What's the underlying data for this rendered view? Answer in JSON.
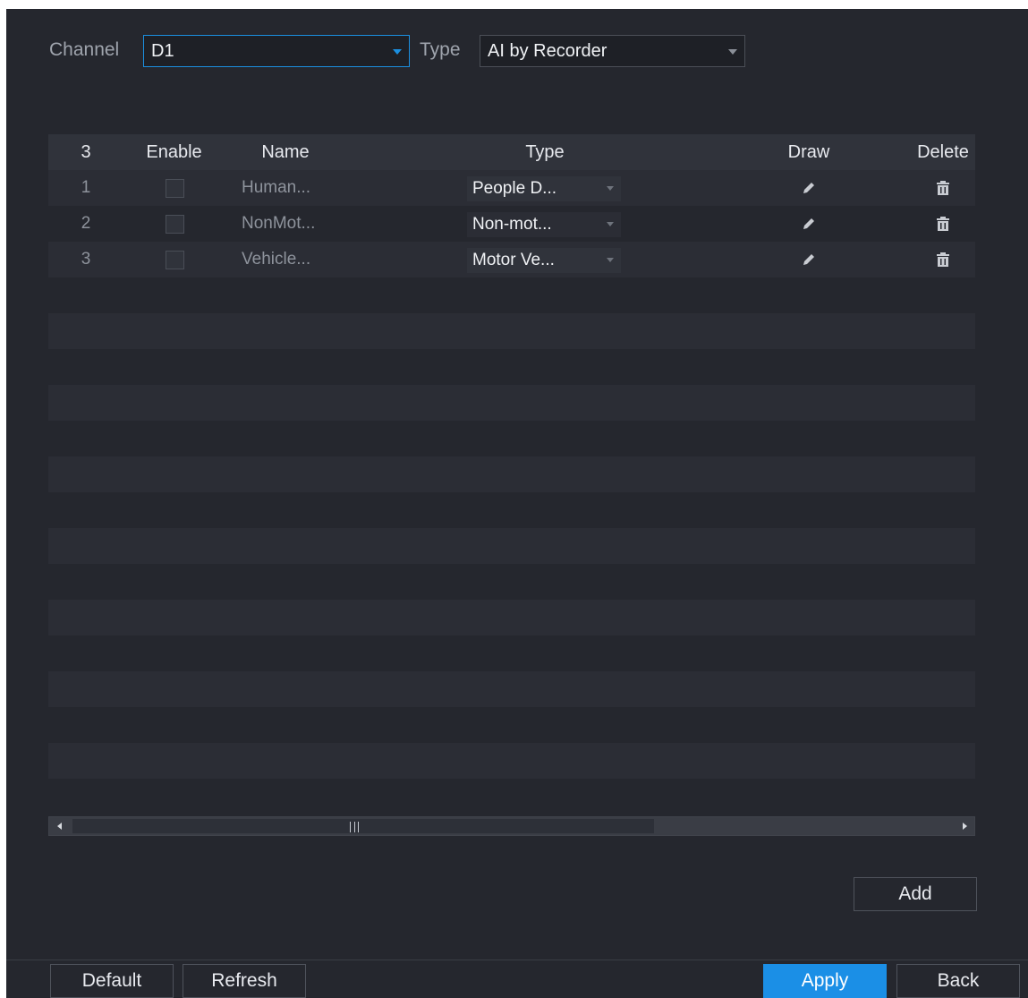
{
  "filters": {
    "channel_label": "Channel",
    "channel_value": "D1",
    "type_label": "Type",
    "type_value": "AI by Recorder"
  },
  "table": {
    "headers": {
      "count": "3",
      "enable": "Enable",
      "name": "Name",
      "type": "Type",
      "draw": "Draw",
      "delete": "Delete"
    },
    "rows": [
      {
        "num": "1",
        "name": "Human...",
        "type": "People D..."
      },
      {
        "num": "2",
        "name": "NonMot...",
        "type": "Non-mot..."
      },
      {
        "num": "3",
        "name": "Vehicle...",
        "type": "Motor Ve..."
      }
    ],
    "total_rows_visible": 17
  },
  "buttons": {
    "add": "Add",
    "default": "Default",
    "refresh": "Refresh",
    "apply": "Apply",
    "back": "Back"
  },
  "icons": {
    "draw": "pencil-icon",
    "delete": "trash-icon",
    "scroll_left": "arrow-left-icon",
    "scroll_right": "arrow-right-icon"
  },
  "colors": {
    "background": "#25272e",
    "accent": "#1b8fe6",
    "header_bg": "#30333b"
  }
}
